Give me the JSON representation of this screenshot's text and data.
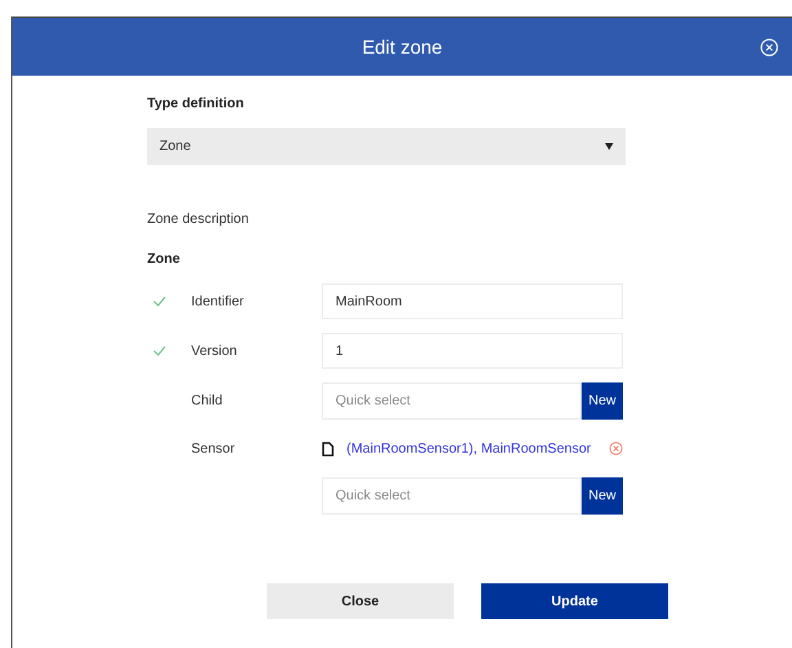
{
  "dialog": {
    "title": "Edit zone"
  },
  "type_definition": {
    "label": "Type definition",
    "value": "Zone"
  },
  "description_label": "Zone description",
  "section_title": "Zone",
  "fields": [
    {
      "kind": "text",
      "label": "Identifier",
      "valid": true,
      "value": "MainRoom"
    },
    {
      "kind": "text",
      "label": "Version",
      "valid": true,
      "value": "1"
    },
    {
      "kind": "picker",
      "label": "Child",
      "valid": false,
      "placeholder": "Quick select",
      "button": "New"
    },
    {
      "kind": "linked",
      "label": "Sensor",
      "valid": false,
      "link": "(MainRoomSensor1), MainRoomSensor",
      "placeholder": "Quick select",
      "button": "New"
    }
  ],
  "buttons": [
    {
      "kind": "secondary",
      "label": "Close"
    },
    {
      "kind": "primary",
      "label": "Update"
    }
  ]
}
